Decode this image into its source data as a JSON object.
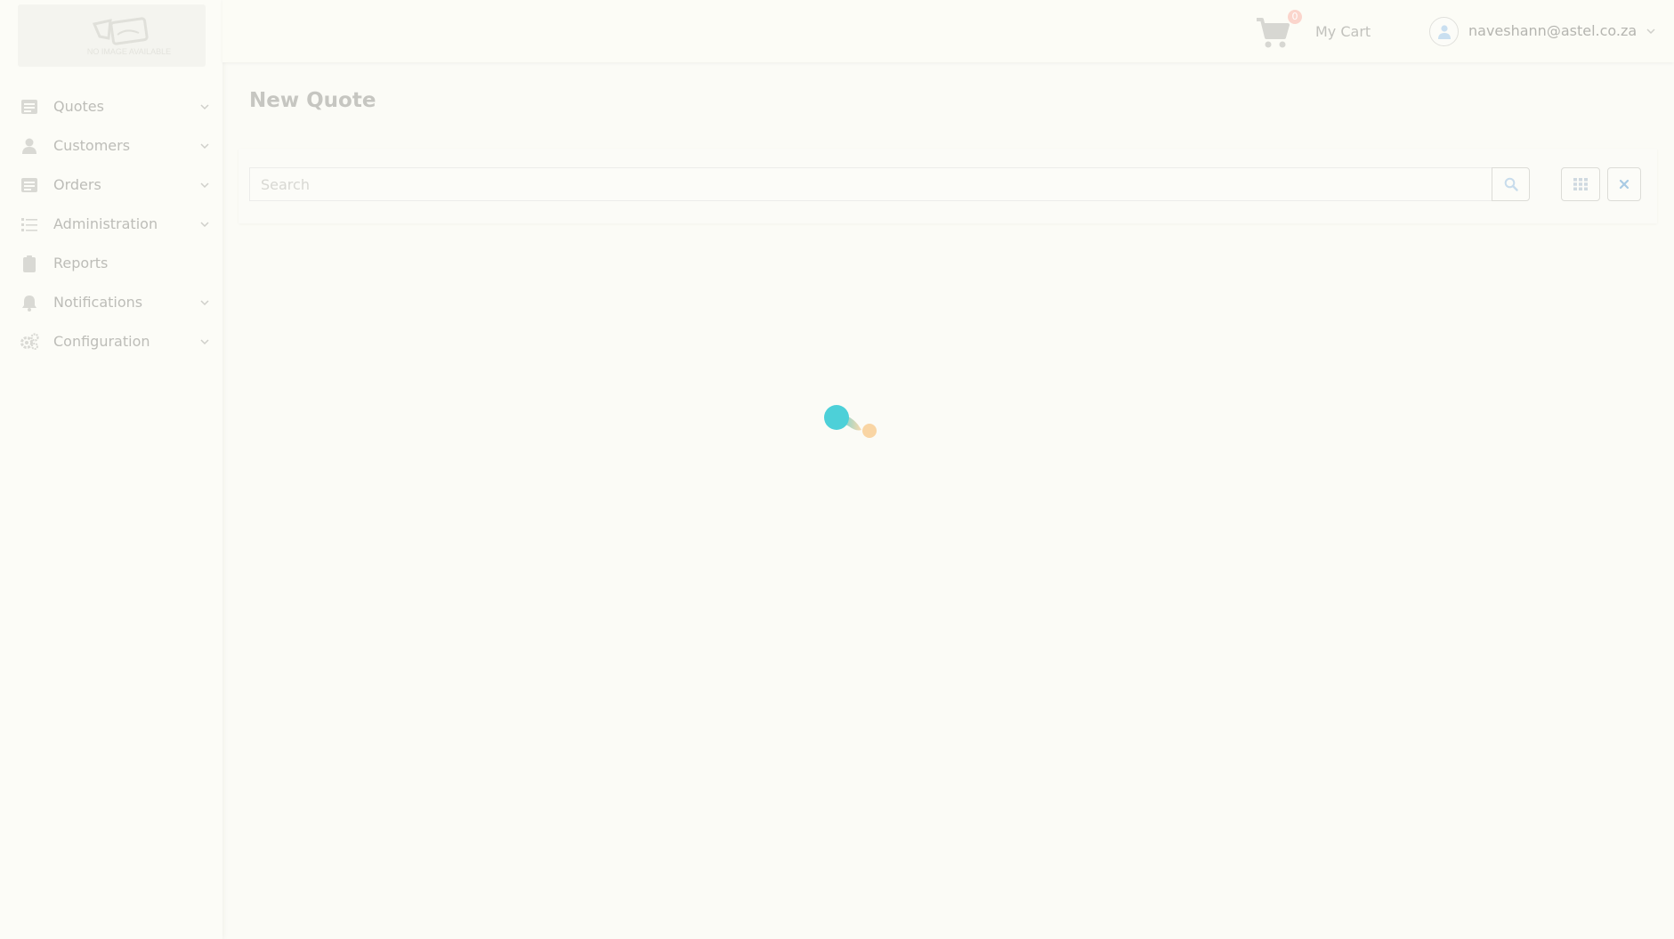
{
  "sidebar": {
    "logo_alt": "NO IMAGE AVAILABLE",
    "items": [
      {
        "label": "Quotes",
        "icon": "list-icon",
        "has_submenu": true
      },
      {
        "label": "Customers",
        "icon": "user-icon",
        "has_submenu": true
      },
      {
        "label": "Orders",
        "icon": "list-icon",
        "has_submenu": true
      },
      {
        "label": "Administration",
        "icon": "tasks-icon",
        "has_submenu": true
      },
      {
        "label": "Reports",
        "icon": "clipboard-icon",
        "has_submenu": false
      },
      {
        "label": "Notifications",
        "icon": "bell-icon",
        "has_submenu": true
      },
      {
        "label": "Configuration",
        "icon": "gears-icon",
        "has_submenu": true
      }
    ]
  },
  "header": {
    "cart_count": "0",
    "cart_label": "My Cart",
    "user_email": "naveshann@astel.co.za"
  },
  "main": {
    "title": "New Quote",
    "search": {
      "placeholder": "Search",
      "value": ""
    }
  },
  "colors": {
    "loader_primary": "#4dd0d8",
    "loader_secondary": "#f9d5a4",
    "badge": "#fbd5cc"
  }
}
